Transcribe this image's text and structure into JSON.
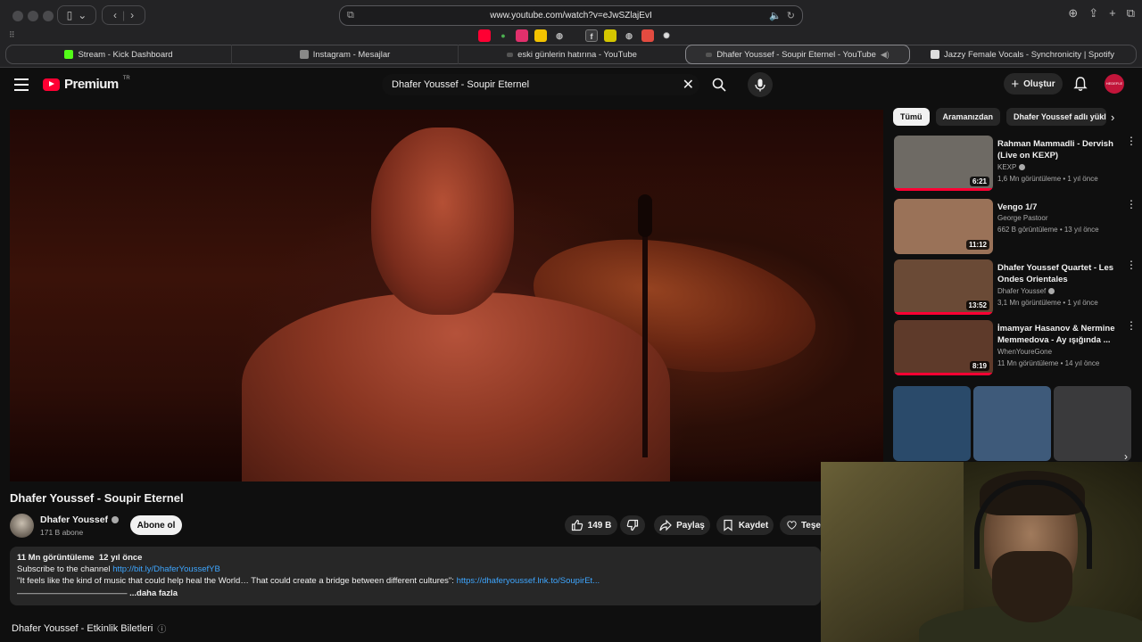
{
  "browser": {
    "url": "www.youtube.com/watch?v=eJwSZlajEvI",
    "tabs": [
      {
        "title": "Stream - Kick Dashboard",
        "icon": "kick-icon"
      },
      {
        "title": "Instagram - Mesajlar",
        "icon": "instagram-icon"
      },
      {
        "title": "eski günlerin hatırına - YouTube",
        "icon": "youtube-icon"
      },
      {
        "title": "Dhafer Youssef - Soupir Eternel - YouTube",
        "icon": "youtube-icon",
        "active": true
      },
      {
        "title": "Jazzy Female Vocals - Synchronicity | Spotify",
        "icon": "spotify-icon"
      }
    ]
  },
  "header": {
    "logo_text": "Premium",
    "logo_region": "TR",
    "search_query": "Dhafer Youssef - Soupir Eternel",
    "create_label": "Oluştur",
    "avatar_text": "HEDEFLE"
  },
  "video": {
    "title": "Dhafer Youssef - Soupir Eternel",
    "channel": "Dhafer Youssef",
    "subscribers": "171 B abone",
    "subscribe_label": "Abone ol",
    "likes": "149 B",
    "share_label": "Paylaş",
    "save_label": "Kaydet",
    "thanks_label": "Teşe"
  },
  "description": {
    "views": "11 Mn görüntüleme",
    "age": "12 yıl önce",
    "line1_text": "Subscribe to the channel ",
    "line1_link": "http://bit.ly/DhaferYoussefYB",
    "line2_text": "\"It feels like the kind of music that could help heal the World… That could create a bridge between different cultures\": ",
    "line2_link": "https://dhaferyoussef.lnk.to/SoupirEt...",
    "line3_text": "—————————————",
    "more_label": "...daha fazla"
  },
  "events_title": "Dhafer Youssef - Etkinlik Biletleri",
  "sidebar": {
    "chips": [
      "Tümü",
      "Aramanızdan",
      "Dhafer Youssef adlı yükl"
    ],
    "recommendations": [
      {
        "title": "Rahman Mammadli - Dervish (Live on KEXP)",
        "channel": "KEXP",
        "verified": true,
        "views": "1,6 Mn görüntüleme",
        "age": "1 yıl önce",
        "duration": "6:21",
        "watched_fraction": 1.0,
        "thumb_color": "#6e6a64"
      },
      {
        "title": "Vengo 1/7",
        "channel": "George Pastoor",
        "verified": false,
        "views": "662 B görüntüleme",
        "age": "13 yıl önce",
        "duration": "11:12",
        "watched_fraction": 0,
        "thumb_color": "#9a7258"
      },
      {
        "title": "Dhafer Youssef Quartet - Les Ondes Orientales",
        "channel": "Dhafer Youssef",
        "verified": true,
        "views": "3,1 Mn görüntüleme",
        "age": "1 yıl önce",
        "duration": "13:52",
        "watched_fraction": 1.0,
        "thumb_color": "#6a4a36"
      },
      {
        "title": "İmamyar Hasanov & Nermine Memmedova - Ay ışığında ...",
        "channel": "WhenYoureGone",
        "verified": false,
        "views": "11 Mn görüntüleme",
        "age": "14 yıl önce",
        "duration": "8:19",
        "watched_fraction": 1.0,
        "thumb_color": "#5e3a2a"
      }
    ],
    "shorts_colors": [
      "#2a4a6a",
      "#3e5a7a",
      "#3a3a3c"
    ]
  }
}
